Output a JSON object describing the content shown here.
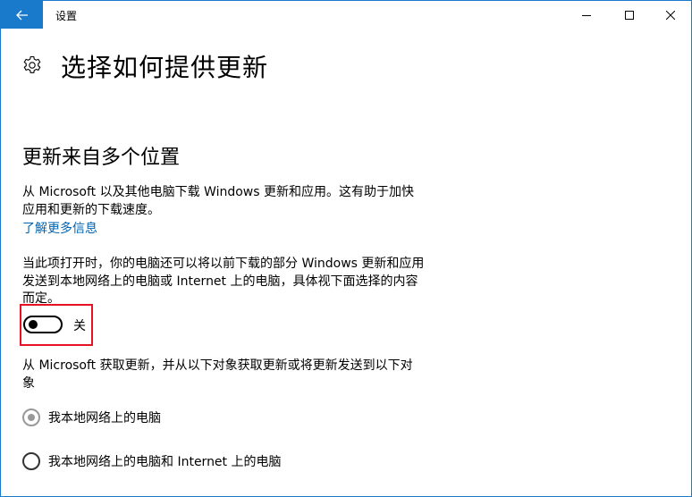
{
  "window": {
    "title": "设置",
    "accent_color": "#1979ca"
  },
  "icons": {
    "back": "back-arrow-icon",
    "minimize": "minimize-icon",
    "maximize": "maximize-icon",
    "close": "close-icon",
    "settings": "gear-icon"
  },
  "page": {
    "title": "选择如何提供更新",
    "section_title": "更新来自多个位置",
    "description": "从 Microsoft 以及其他电脑下载 Windows 更新和应用。这有助于加快应用和更新的下载速度。",
    "learn_more": "了解更多信息",
    "toggle_description": "当此项打开时，你的电脑还可以将以前下载的部分 Windows 更新和应用发送到本地网络上的电脑或 Internet 上的电脑，具体视下面选择的内容而定。",
    "toggle": {
      "state_label": "关",
      "on": false
    },
    "radio_description": "从 Microsoft 获取更新，并从以下对象获取更新或将更新发送到以下对象",
    "options": [
      {
        "label": "我本地网络上的电脑",
        "selected": true,
        "enabled": false
      },
      {
        "label": "我本地网络上的电脑和 Internet 上的电脑",
        "selected": false,
        "enabled": true
      }
    ],
    "link_color": "#0063b1",
    "highlight_color": "#e81123"
  }
}
